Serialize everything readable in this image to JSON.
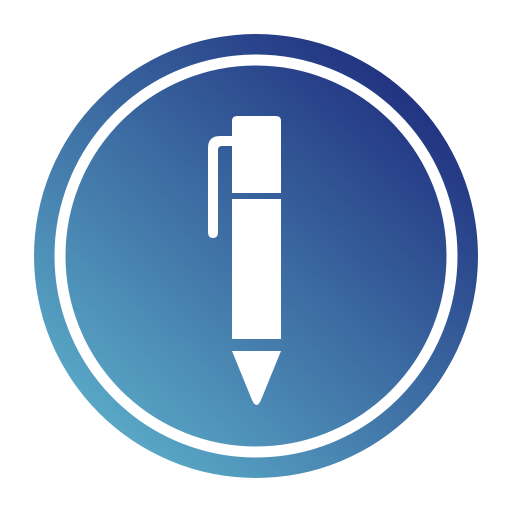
{
  "icon": {
    "name": "pen-icon",
    "gradient_colors": {
      "top_right": "#20307f",
      "bottom_left": "#5aaac7"
    },
    "ring_color": "#ffffff",
    "glyph_color": "#ffffff"
  }
}
